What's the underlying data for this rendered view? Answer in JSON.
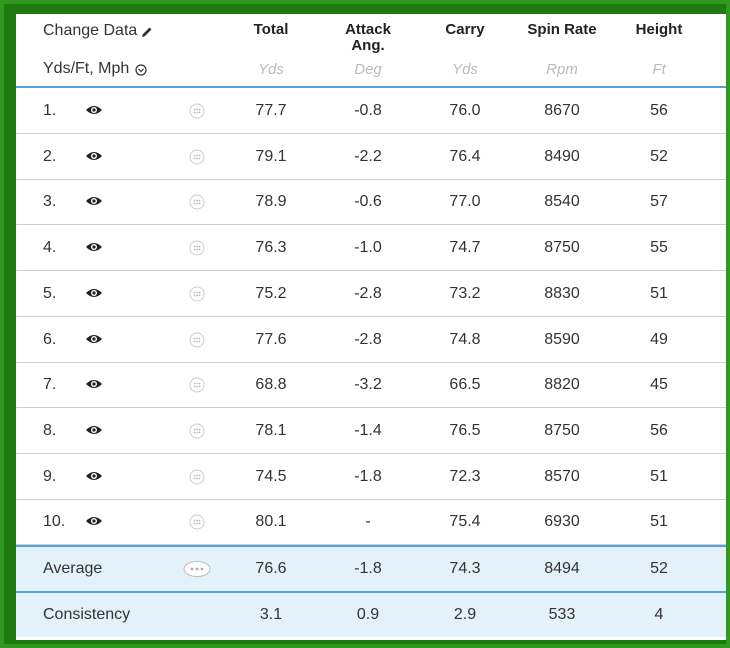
{
  "header": {
    "change_data_label": "Change Data",
    "units_label": "Yds/Ft, Mph",
    "columns": [
      {
        "label": "Total",
        "unit": "Yds"
      },
      {
        "label": "Attack Ang.",
        "unit": "Deg"
      },
      {
        "label": "Carry",
        "unit": "Yds"
      },
      {
        "label": "Spin Rate",
        "unit": "Rpm"
      },
      {
        "label": "Height",
        "unit": "Ft"
      }
    ]
  },
  "rows": [
    {
      "index": "1.",
      "total": "77.7",
      "attack": "-0.8",
      "carry": "76.0",
      "spin": "8670",
      "height": "56"
    },
    {
      "index": "2.",
      "total": "79.1",
      "attack": "-2.2",
      "carry": "76.4",
      "spin": "8490",
      "height": "52"
    },
    {
      "index": "3.",
      "total": "78.9",
      "attack": "-0.6",
      "carry": "77.0",
      "spin": "8540",
      "height": "57"
    },
    {
      "index": "4.",
      "total": "76.3",
      "attack": "-1.0",
      "carry": "74.7",
      "spin": "8750",
      "height": "55"
    },
    {
      "index": "5.",
      "total": "75.2",
      "attack": "-2.8",
      "carry": "73.2",
      "spin": "8830",
      "height": "51"
    },
    {
      "index": "6.",
      "total": "77.6",
      "attack": "-2.8",
      "carry": "74.8",
      "spin": "8590",
      "height": "49"
    },
    {
      "index": "7.",
      "total": "68.8",
      "attack": "-3.2",
      "carry": "66.5",
      "spin": "8820",
      "height": "45"
    },
    {
      "index": "8.",
      "total": "78.1",
      "attack": "-1.4",
      "carry": "76.5",
      "spin": "8750",
      "height": "56"
    },
    {
      "index": "9.",
      "total": "74.5",
      "attack": "-1.8",
      "carry": "72.3",
      "spin": "8570",
      "height": "51"
    },
    {
      "index": "10.",
      "total": "80.1",
      "attack": "-",
      "carry": "75.4",
      "spin": "6930",
      "height": "51"
    }
  ],
  "average": {
    "label": "Average",
    "total": "76.6",
    "attack": "-1.8",
    "carry": "74.3",
    "spin": "8494",
    "height": "52"
  },
  "consistency": {
    "label": "Consistency",
    "total": "3.1",
    "attack": "0.9",
    "carry": "2.9",
    "spin": "533",
    "height": "4"
  },
  "colors": {
    "frame": "#1f7a10",
    "accent_line": "#5aa0d8",
    "summary_bg": "#e3f1fb"
  },
  "icons": {
    "row_visibility": "eye-icon",
    "row_details": "dots-circle-icon",
    "edit": "pencil-icon",
    "dropdown": "chevron-down-circle-icon"
  }
}
